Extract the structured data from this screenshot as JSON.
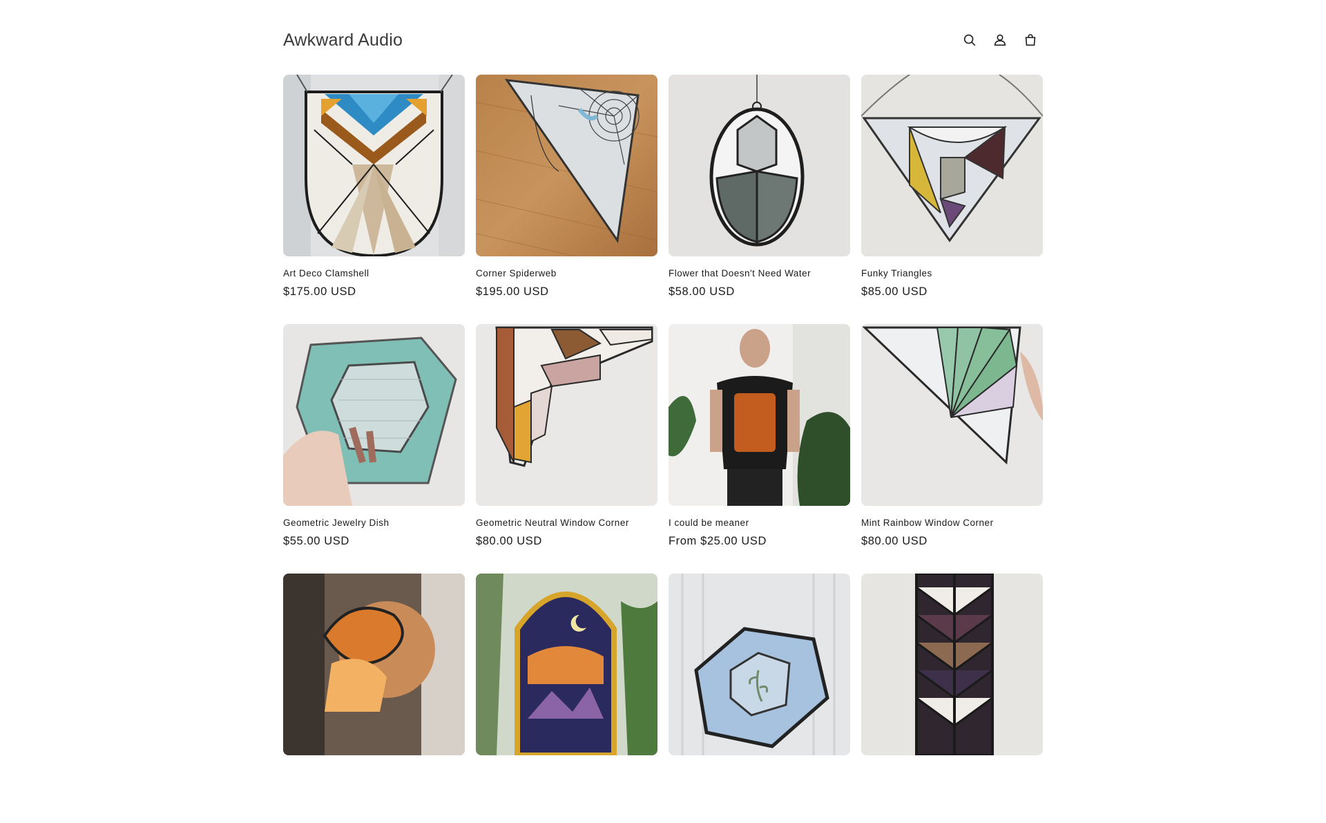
{
  "header": {
    "store_name": "Awkward Audio",
    "icons": [
      "search-icon",
      "account-icon",
      "cart-icon"
    ]
  },
  "products": [
    {
      "title": "Art Deco Clamshell",
      "price": "$175.00 USD"
    },
    {
      "title": "Corner Spiderweb",
      "price": "$195.00 USD"
    },
    {
      "title": "Flower that Doesn't Need Water",
      "price": "$58.00 USD"
    },
    {
      "title": "Funky Triangles",
      "price": "$85.00 USD"
    },
    {
      "title": "Geometric Jewelry Dish",
      "price": "$55.00 USD"
    },
    {
      "title": "Geometric Neutral Window Corner",
      "price": "$80.00 USD"
    },
    {
      "title": "I could be meaner",
      "price": "From $25.00 USD"
    },
    {
      "title": "Mint Rainbow Window Corner",
      "price": "$80.00 USD"
    },
    {
      "title": "",
      "price": ""
    },
    {
      "title": "",
      "price": ""
    },
    {
      "title": "",
      "price": ""
    },
    {
      "title": "",
      "price": ""
    }
  ],
  "colors": {
    "text": "#121212",
    "background": "#ffffff"
  }
}
